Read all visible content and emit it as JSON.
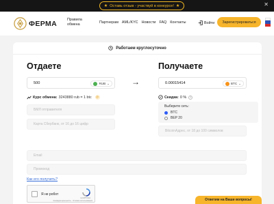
{
  "promo": {
    "text": "Оставь отзыв - участвуй в конкурсе!"
  },
  "header": {
    "brand": "ФЕРМА",
    "rules": "Правила обмена",
    "nav": [
      "Партнерам",
      "AML/KYC",
      "Новости",
      "FAQ",
      "Контакты"
    ],
    "login": "Войти",
    "register": "Зарегистрироваться"
  },
  "card": {
    "banner": "Работаем круглосуточно",
    "give": {
      "title": "Отдаете",
      "amount": "500",
      "currency": "RUB",
      "rate_label": "Курс обмена:",
      "rate_value": "3243880 rub = 1 btc",
      "phone_placeholder": "БМЛ отправителя",
      "card_placeholder": "Карта Сбербанк, от 16 до 16 цифр"
    },
    "get": {
      "title": "Получаете",
      "amount": "0.00015414",
      "currency": "BTC",
      "discount_label": "Скидка:",
      "discount_value": "0 %",
      "network_label": "Выберите сеть:",
      "networks": [
        "BTC",
        "BEP 20"
      ],
      "selected_network": "BTC",
      "wallet_placeholder": "BitcoinАдрес, от 18 до 100 символов"
    },
    "email_placeholder": "Email",
    "promo_placeholder": "Промокод",
    "how_link": "Как его получить?",
    "captcha_label": "Я не робот",
    "captcha_brand": "reCAPTCHA",
    "captcha_terms": "Конфиденциальность - Условия использования"
  },
  "chat": {
    "label": "Ответим на Ваши вопросы!"
  },
  "colors": {
    "accent": "#f7b52c",
    "dark": "#151515",
    "link": "#3a6fd8",
    "radio": "#2f5cf5"
  }
}
